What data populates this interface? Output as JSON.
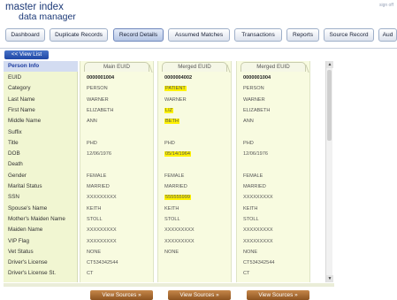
{
  "header": {
    "brand_line1": "master index",
    "brand_line2": "data manager",
    "top_link": "sign off"
  },
  "nav": [
    "Dashboard",
    "Duplicate Records",
    "Record Details",
    "Assumed Matches",
    "Transactions",
    "Reports",
    "Source Record",
    "Aud"
  ],
  "view_list_label": "<< View List",
  "labels_header": "Person Info",
  "labels": [
    "EUID",
    "Category",
    "Last Name",
    "First Name",
    "Middle Name",
    "Suffix",
    "Title",
    "DOB",
    "Death",
    "Gender",
    "Marital Status",
    "SSN",
    "Spouse's Name",
    "Mother's Maiden Name",
    "Maiden Name",
    "VIP Flag",
    "Vet Status",
    "Driver's License",
    "Driver's License St."
  ],
  "columns": [
    {
      "title": "Main EUID",
      "values": [
        "0000001004",
        "PERSON",
        "WARNER",
        "ELIZABETH",
        "ANN",
        "",
        "PHD",
        "12/06/1976",
        "",
        "FEMALE",
        "MARRIED",
        "XXXXXXXXX",
        "KEITH",
        "STOLL",
        "XXXXXXXXX",
        "XXXXXXXXX",
        "NONE",
        "CT534342544",
        "CT"
      ],
      "highlight": []
    },
    {
      "title": "Merged EUID",
      "values": [
        "0000004002",
        "PATIENT",
        "WARNER",
        "LIZ",
        "BETH",
        "",
        "PHD",
        "05/14/1964",
        "",
        "FEMALE",
        "MARRIED",
        "555555999",
        "KEITH",
        "STOLL",
        "XXXXXXXXX",
        "XXXXXXXXX",
        "NONE",
        "",
        ""
      ],
      "highlight": [
        1,
        3,
        4,
        7,
        11
      ]
    },
    {
      "title": "Merged EUID",
      "values": [
        "0000001004",
        "PERSON",
        "WARNER",
        "ELIZABETH",
        "ANN",
        "",
        "PHD",
        "12/06/1976",
        "",
        "FEMALE",
        "MARRIED",
        "XXXXXXXXX",
        "KEITH",
        "STOLL",
        "XXXXXXXXX",
        "XXXXXXXXX",
        "NONE",
        "CT534342544",
        "CT"
      ],
      "highlight": []
    }
  ],
  "view_sources_label": "View Sources »"
}
